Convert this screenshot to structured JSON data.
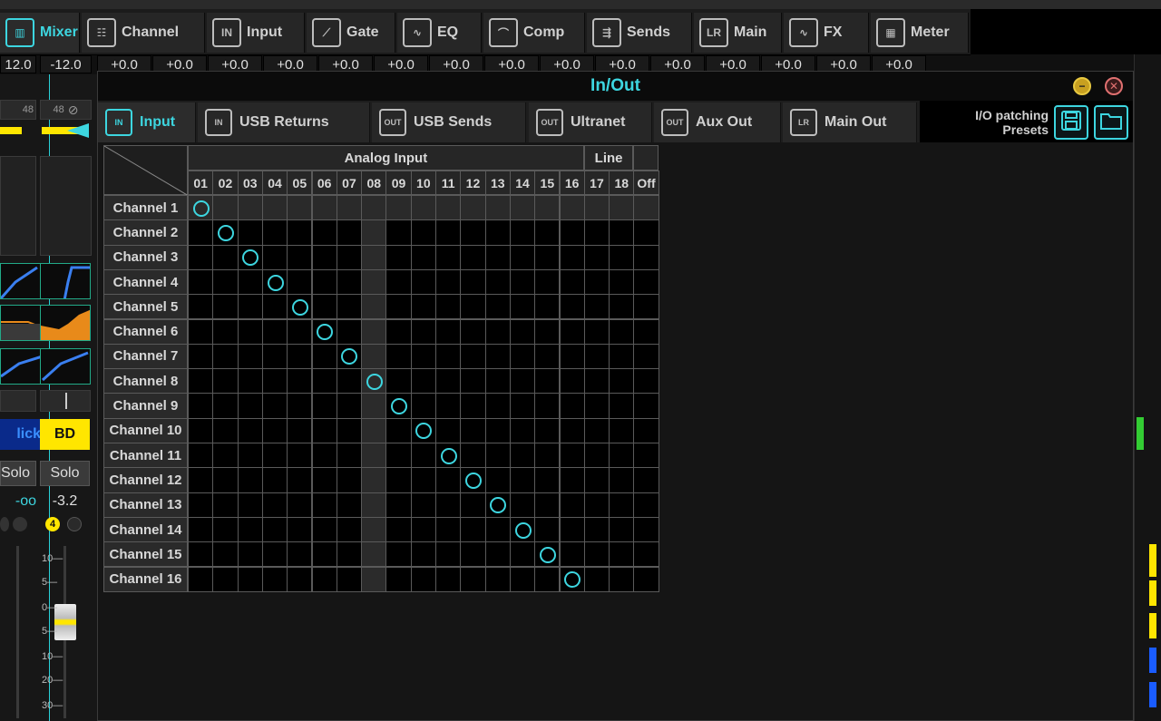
{
  "top_tabs": [
    {
      "label": "Mixer",
      "icon": "mixer-icon",
      "active": true
    },
    {
      "label": "Channel",
      "icon": "channel-icon",
      "active": false
    },
    {
      "label": "Input",
      "icon": "input-icon",
      "active": false
    },
    {
      "label": "Gate",
      "icon": "gate-icon",
      "active": false
    },
    {
      "label": "EQ",
      "icon": "eq-icon",
      "active": false
    },
    {
      "label": "Comp",
      "icon": "comp-icon",
      "active": false
    },
    {
      "label": "Sends",
      "icon": "sends-icon",
      "active": false
    },
    {
      "label": "Main",
      "icon": "main-icon",
      "active": false
    },
    {
      "label": "FX",
      "icon": "fx-icon",
      "active": false
    },
    {
      "label": "Meter",
      "icon": "meter-icon",
      "active": false
    }
  ],
  "gain_row": [
    "12.0",
    "-12.0",
    "+0.0",
    "+0.0",
    "+0.0",
    "+0.0",
    "+0.0",
    "+0.0",
    "+0.0",
    "+0.0",
    "+0.0",
    "+0.0",
    "+0.0",
    "+0.0",
    "+0.0",
    "+0.0",
    "+0.0"
  ],
  "left_strips": {
    "strip1": {
      "name": "lick",
      "solo": "Solo",
      "level": "-oo",
      "value_48": "48"
    },
    "strip2": {
      "name": "BD",
      "solo": "Solo",
      "level": "-3.2",
      "value_48": "48",
      "badge": "4"
    },
    "fader_scale": [
      "10",
      "5",
      "0",
      "5",
      "10",
      "20",
      "30"
    ]
  },
  "dialog": {
    "title": "In/Out",
    "tabs": [
      {
        "label": "Input",
        "icon": "in-icon",
        "active": true
      },
      {
        "label": "USB Returns",
        "icon": "in-icon",
        "active": false
      },
      {
        "label": "USB Sends",
        "icon": "out-icon",
        "active": false
      },
      {
        "label": "Ultranet",
        "icon": "out-icon",
        "active": false
      },
      {
        "label": "Aux Out",
        "icon": "out-icon",
        "active": false
      },
      {
        "label": "Main Out",
        "icon": "main-lr-icon",
        "active": false
      }
    ],
    "presets_label_line1": "I/O patching",
    "presets_label_line2": "Presets"
  },
  "patch_grid": {
    "group_headers": [
      "Analog Input",
      "Line"
    ],
    "columns": [
      "01",
      "02",
      "03",
      "04",
      "05",
      "06",
      "07",
      "08",
      "09",
      "10",
      "11",
      "12",
      "13",
      "14",
      "15",
      "16",
      "17",
      "18",
      "Off"
    ],
    "rows": [
      "Channel 1",
      "Channel 2",
      "Channel 3",
      "Channel 4",
      "Channel 5",
      "Channel 6",
      "Channel 7",
      "Channel 8",
      "Channel 9",
      "Channel 10",
      "Channel 11",
      "Channel 12",
      "Channel 13",
      "Channel 14",
      "Channel 15",
      "Channel 16"
    ],
    "assignments": [
      0,
      1,
      2,
      3,
      4,
      5,
      6,
      7,
      8,
      9,
      10,
      11,
      12,
      13,
      14,
      15
    ]
  },
  "colors": {
    "accent": "#3dd6e0",
    "yellow": "#ffe600",
    "orange": "#e88a1a"
  }
}
